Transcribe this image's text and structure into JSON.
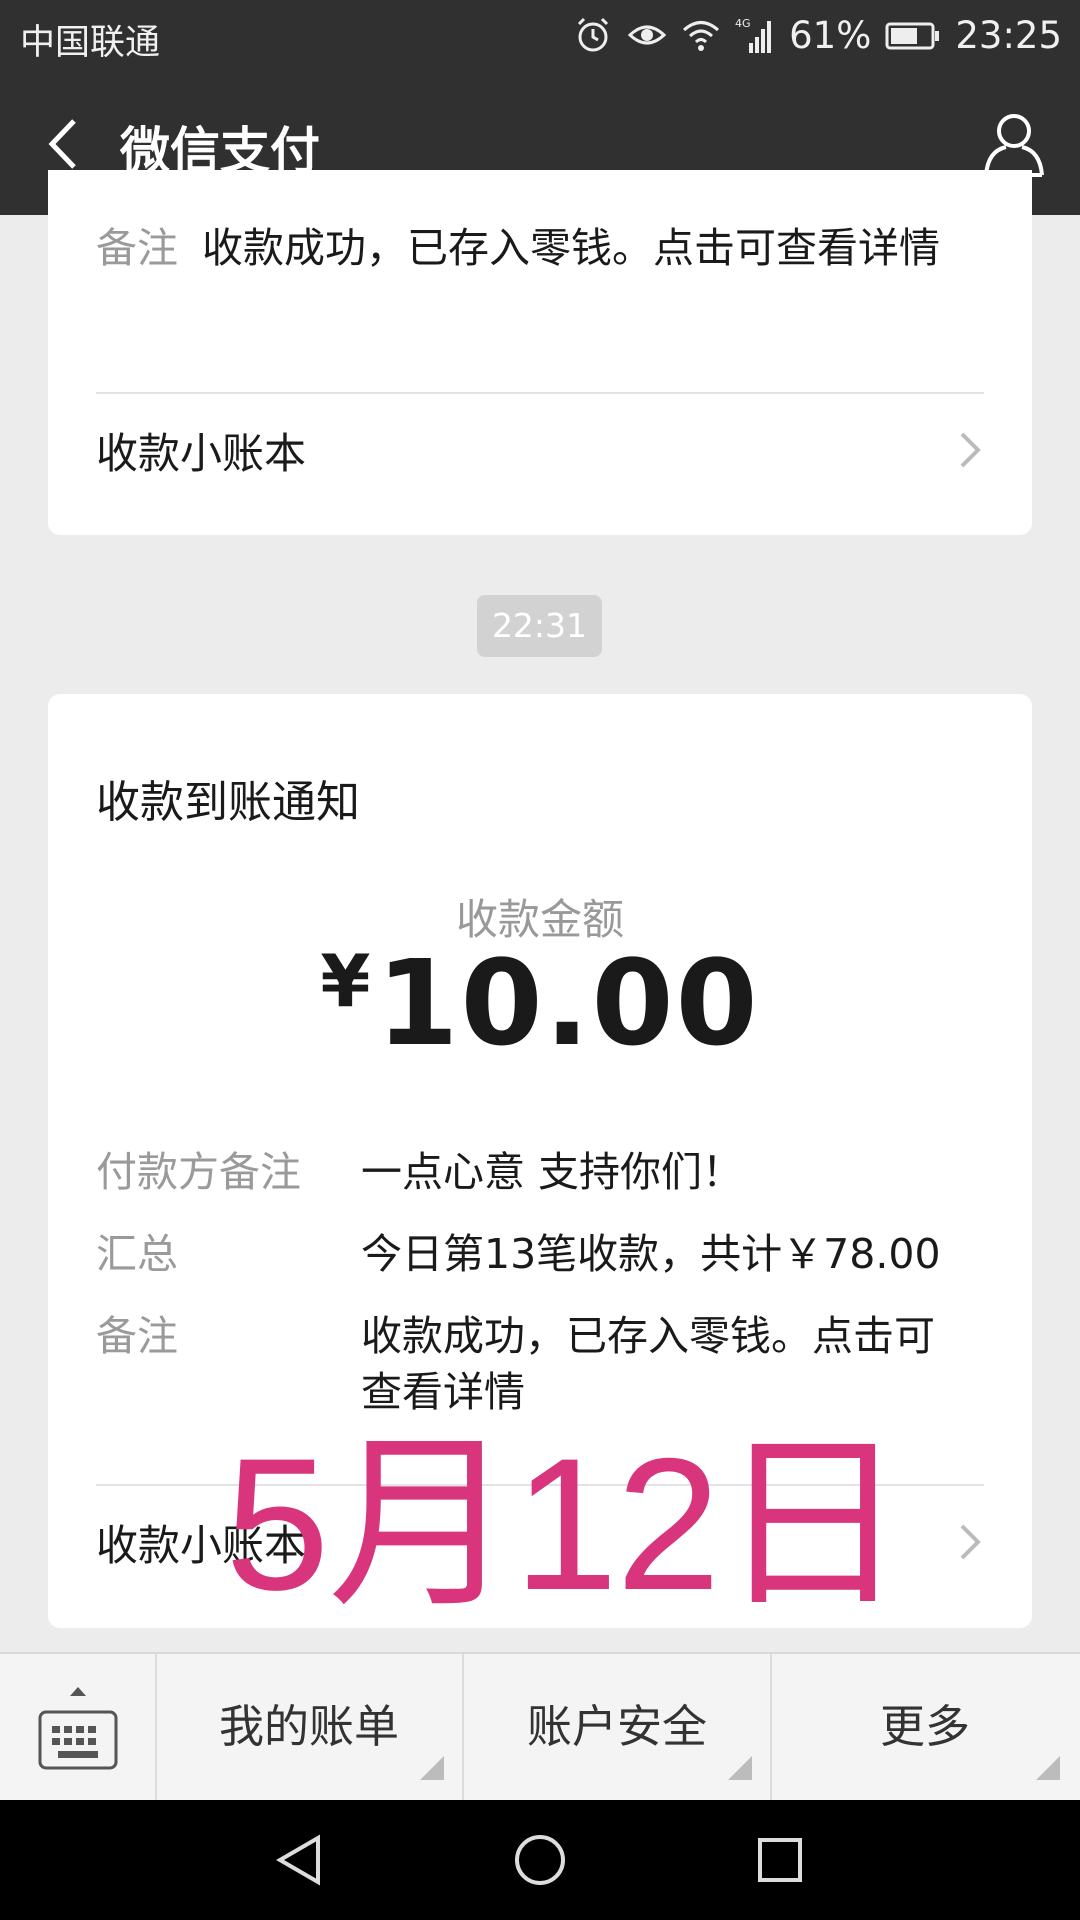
{
  "status_bar": {
    "carrier": "中国联通",
    "battery_percent": "61%",
    "time": "23:25",
    "network": "4G",
    "icons": [
      "alarm-icon",
      "eye-icon",
      "wifi-icon",
      "signal-icon",
      "battery-icon"
    ]
  },
  "header": {
    "title": "微信支付",
    "back_icon": "back-arrow-icon",
    "profile_icon": "person-icon"
  },
  "previous_message": {
    "note_label": "备注",
    "note_value": "收款成功，已存入零钱。点击可查看详情",
    "ledger_link": "收款小账本"
  },
  "timestamp": "22:31",
  "payment_card": {
    "heading": "收款到账通知",
    "amount_label": "收款金额",
    "currency": "¥",
    "amount": "10.00",
    "rows": [
      {
        "label": "付款方备注",
        "value": "一点心意 支持你们！"
      },
      {
        "label": "汇总",
        "value": "今日第13笔收款，共计￥78.00"
      },
      {
        "label": "备注",
        "value": "收款成功，已存入零钱。点击可查看详情"
      }
    ],
    "ledger_link": "收款小账本"
  },
  "overlay_text": "5月12日",
  "bottom_menu": {
    "keyboard_icon": "keyboard-icon",
    "items": [
      "我的账单",
      "账户安全",
      "更多"
    ]
  },
  "nav_bar": [
    "back-triangle-icon",
    "home-circle-icon",
    "recents-square-icon"
  ],
  "colors": {
    "header_bg": "#303030",
    "page_bg": "#ececec",
    "watermark": "#d8357c"
  }
}
